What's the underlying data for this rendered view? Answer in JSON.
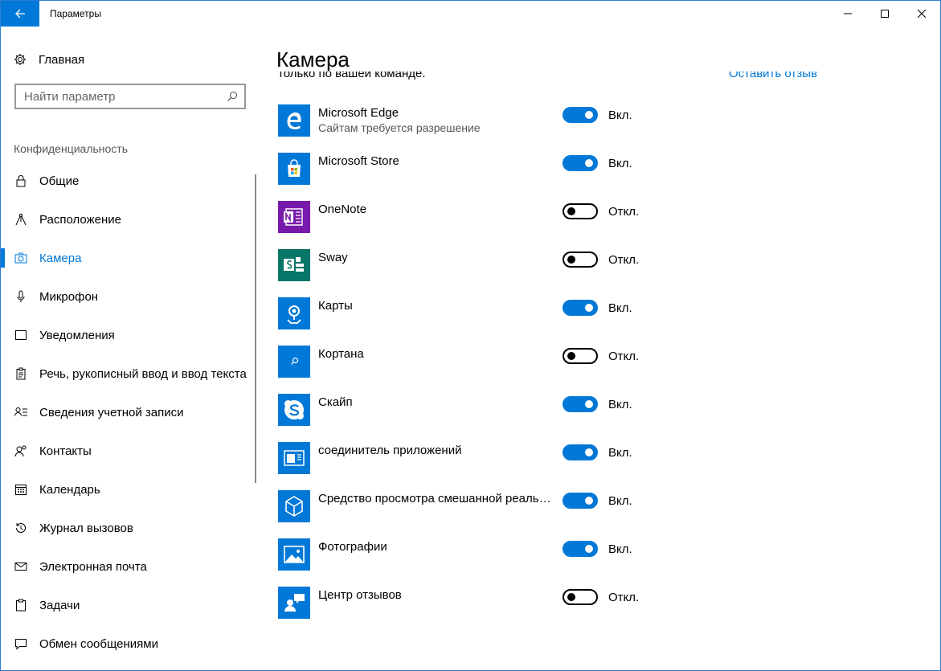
{
  "window": {
    "title": "Параметры"
  },
  "sidebar": {
    "home_label": "Главная",
    "search_placeholder": "Найти параметр",
    "section": "Конфиденциальность",
    "items": [
      {
        "label": "Общие",
        "icon": "lock-icon",
        "active": false
      },
      {
        "label": "Расположение",
        "icon": "location-icon",
        "active": false
      },
      {
        "label": "Камера",
        "icon": "camera-icon",
        "active": true
      },
      {
        "label": "Микрофон",
        "icon": "microphone-icon",
        "active": false
      },
      {
        "label": "Уведомления",
        "icon": "notification-icon",
        "active": false
      },
      {
        "label": "Речь, рукописный ввод и ввод текста",
        "icon": "clipboard-icon",
        "active": false
      },
      {
        "label": "Сведения учетной записи",
        "icon": "account-info-icon",
        "active": false
      },
      {
        "label": "Контакты",
        "icon": "contacts-icon",
        "active": false
      },
      {
        "label": "Календарь",
        "icon": "calendar-icon",
        "active": false
      },
      {
        "label": "Журнал вызовов",
        "icon": "history-icon",
        "active": false
      },
      {
        "label": "Электронная почта",
        "icon": "mail-icon",
        "active": false
      },
      {
        "label": "Задачи",
        "icon": "tasks-icon",
        "active": false
      },
      {
        "label": "Обмен сообщениями",
        "icon": "message-icon",
        "active": false
      }
    ]
  },
  "main": {
    "title": "Камера",
    "clipped_text": "только по вашей команде.",
    "clipped_link": "Оставить отзыв",
    "apps": [
      {
        "name": "Microsoft Edge",
        "sub": "Сайтам требуется разрешение",
        "on": true,
        "state": "Вкл.",
        "icon": "edge-icon",
        "color": "#0078d7"
      },
      {
        "name": "Microsoft Store",
        "sub": "",
        "on": true,
        "state": "Вкл.",
        "icon": "store-icon",
        "color": "#0078d7"
      },
      {
        "name": "OneNote",
        "sub": "",
        "on": false,
        "state": "Откл.",
        "icon": "onenote-icon",
        "color": "#7719aa"
      },
      {
        "name": "Sway",
        "sub": "",
        "on": false,
        "state": "Откл.",
        "icon": "sway-icon",
        "color": "#077568"
      },
      {
        "name": "Карты",
        "sub": "",
        "on": true,
        "state": "Вкл.",
        "icon": "maps-icon",
        "color": "#0078d7"
      },
      {
        "name": "Кортана",
        "sub": "",
        "on": false,
        "state": "Откл.",
        "icon": "cortana-icon",
        "color": "#0078d7"
      },
      {
        "name": "Скайп",
        "sub": "",
        "on": true,
        "state": "Вкл.",
        "icon": "skype-icon",
        "color": "#0078d7"
      },
      {
        "name": "соединитель приложений",
        "sub": "",
        "on": true,
        "state": "Вкл.",
        "icon": "app-connector-icon",
        "color": "#0078d7"
      },
      {
        "name": "Средство просмотра смешанной реальности",
        "sub": "",
        "on": true,
        "state": "Вкл.",
        "icon": "mixed-reality-icon",
        "color": "#0078d7"
      },
      {
        "name": "Фотографии",
        "sub": "",
        "on": true,
        "state": "Вкл.",
        "icon": "photos-icon",
        "color": "#0078d7"
      },
      {
        "name": "Центр отзывов",
        "sub": "",
        "on": false,
        "state": "Откл.",
        "icon": "feedback-hub-icon",
        "color": "#0078d7"
      }
    ]
  }
}
